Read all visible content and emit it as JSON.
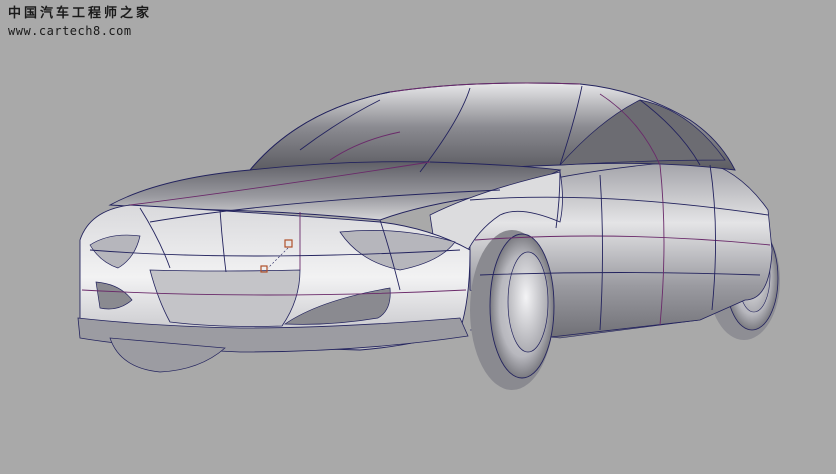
{
  "watermark": {
    "title": "中国汽车工程师之家",
    "url": "www.cartech8.com"
  },
  "colors": {
    "background": "#a9a9a9",
    "surface_light": "#eeeeee",
    "surface_mid": "#c9c9cc",
    "surface_dark": "#6b6b70",
    "iso_line_blue": "#23235e",
    "iso_line_purple": "#6a2a6a",
    "pick_marker": "#b0502a"
  },
  "model": {
    "icon": "nurbs-car-surface-model",
    "view": "perspective-shaded-wireframe"
  }
}
